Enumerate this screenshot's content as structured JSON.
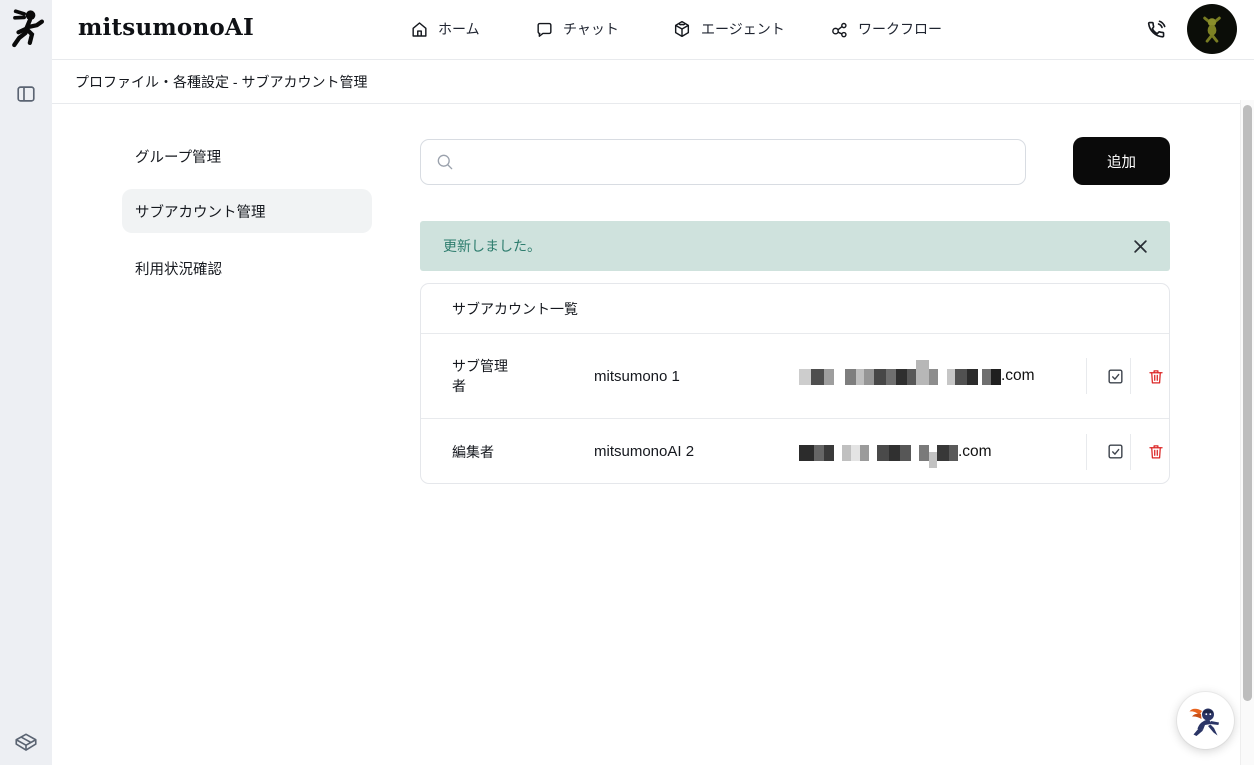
{
  "brand": {
    "title": "mitsumonoAI"
  },
  "top_nav": {
    "items": [
      {
        "label": "ホーム",
        "icon": "home-icon"
      },
      {
        "label": "チャット",
        "icon": "chat-icon"
      },
      {
        "label": "エージェント",
        "icon": "agent-cube-icon"
      },
      {
        "label": "ワークフロー",
        "icon": "workflow-icon"
      }
    ]
  },
  "breadcrumb": {
    "text": "プロファイル・各種設定 - サブアカウント管理"
  },
  "side_menu": {
    "items": [
      {
        "label": "グループ管理",
        "active": false
      },
      {
        "label": "サブアカウント管理",
        "active": true
      },
      {
        "label": "利用状況確認",
        "active": false
      }
    ]
  },
  "toolbar": {
    "search_value": "",
    "search_placeholder": "",
    "add_button_label": "追加"
  },
  "alert": {
    "message": "更新しました。"
  },
  "account_table": {
    "title": "サブアカウント一覧",
    "rows": [
      {
        "role": "サブ管理者",
        "name": "mitsumono 1",
        "email_redacted": true,
        "email_visible_suffix": ".com"
      },
      {
        "role": "編集者",
        "name": "mitsumonoAI 2",
        "email_redacted": true,
        "email_visible_suffix": ".com"
      }
    ]
  },
  "colors": {
    "accent_black": "#0a0a0a",
    "alert_bg": "#cfe2dd",
    "alert_text": "#2e7d6e",
    "danger_red": "#dc2626",
    "rail_bg": "#edeff3",
    "active_item_bg": "#f1f3f4"
  }
}
